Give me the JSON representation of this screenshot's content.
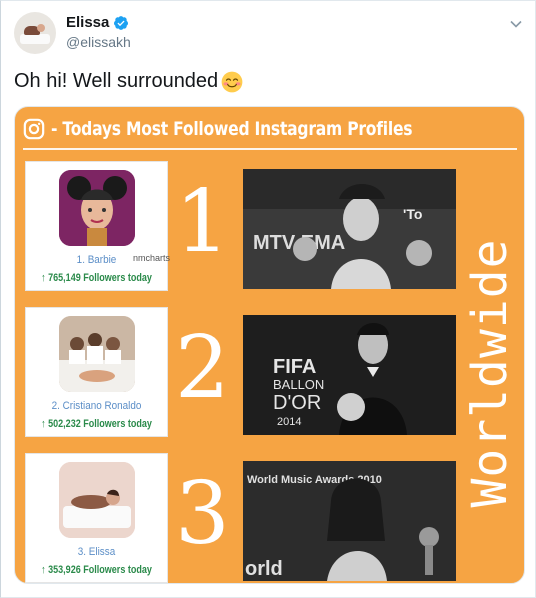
{
  "tweet": {
    "display_name": "Elissa",
    "handle": "@elissakh",
    "text": "Oh hi! Well surrounded",
    "emoji": "smiling-face-emoji"
  },
  "media": {
    "banner_title": "- Todays Most Followed Instagram Profiles",
    "side_label": "Worldwide",
    "watermark": "nmcharts",
    "entries": [
      {
        "rank": "1",
        "rank_label": "1. Barbie",
        "followers": "765,149 Followers today"
      },
      {
        "rank": "2",
        "rank_label": "2. Cristiano Ronaldo",
        "followers": "502,232 Followers today"
      },
      {
        "rank": "3",
        "rank_label": "3. Elissa",
        "followers": "353,926 Followers today"
      }
    ],
    "photo_texts": {
      "p1": "MTV EMA",
      "p2_a": "FIFA",
      "p2_b": "BALLON",
      "p2_c": "D'OR",
      "p2_d": "2014",
      "p3_a": "World Music Awards 2010",
      "p3_b": "orld"
    }
  },
  "colors": {
    "banner_bg": "#f6a443",
    "verified": "#1da1f2",
    "follower_green": "#2a8a4a",
    "rank_blue": "#5b8ec7"
  }
}
